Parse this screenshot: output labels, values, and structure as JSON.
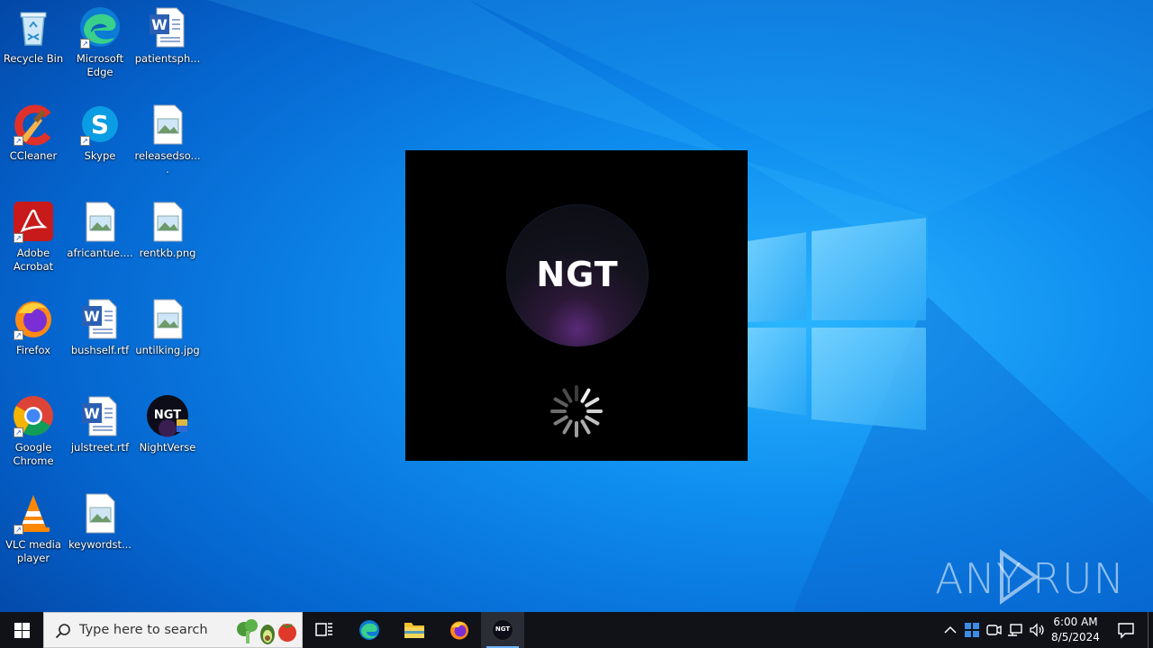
{
  "desktop": {
    "icons": [
      {
        "label": "Recycle Bin"
      },
      {
        "label": "Microsoft Edge"
      },
      {
        "label": "patientsph..."
      },
      {
        "label": "CCleaner"
      },
      {
        "label": "Skype"
      },
      {
        "label": "releasedso...."
      },
      {
        "label": "Adobe Acrobat"
      },
      {
        "label": "africantue...."
      },
      {
        "label": "rentkb.png"
      },
      {
        "label": "Firefox"
      },
      {
        "label": "bushself.rtf"
      },
      {
        "label": "untilking.jpg"
      },
      {
        "label": "Google Chrome"
      },
      {
        "label": "julstreet.rtf"
      },
      {
        "label": "NightVerse"
      },
      {
        "label": "VLC media player"
      },
      {
        "label": "keywordst..."
      }
    ]
  },
  "splash": {
    "logo_text": "NGT"
  },
  "watermark": {
    "text_left": "ANY",
    "text_right": "RUN"
  },
  "taskbar": {
    "search_placeholder": "Type here to search",
    "time": "6:00 AM",
    "date": "8/5/2024",
    "ngt_icon_text": "NGT"
  },
  "colors": {
    "taskbar_bg": "#101218",
    "desktop_blue": "#0a73d9",
    "splash_bg": "#000000"
  }
}
